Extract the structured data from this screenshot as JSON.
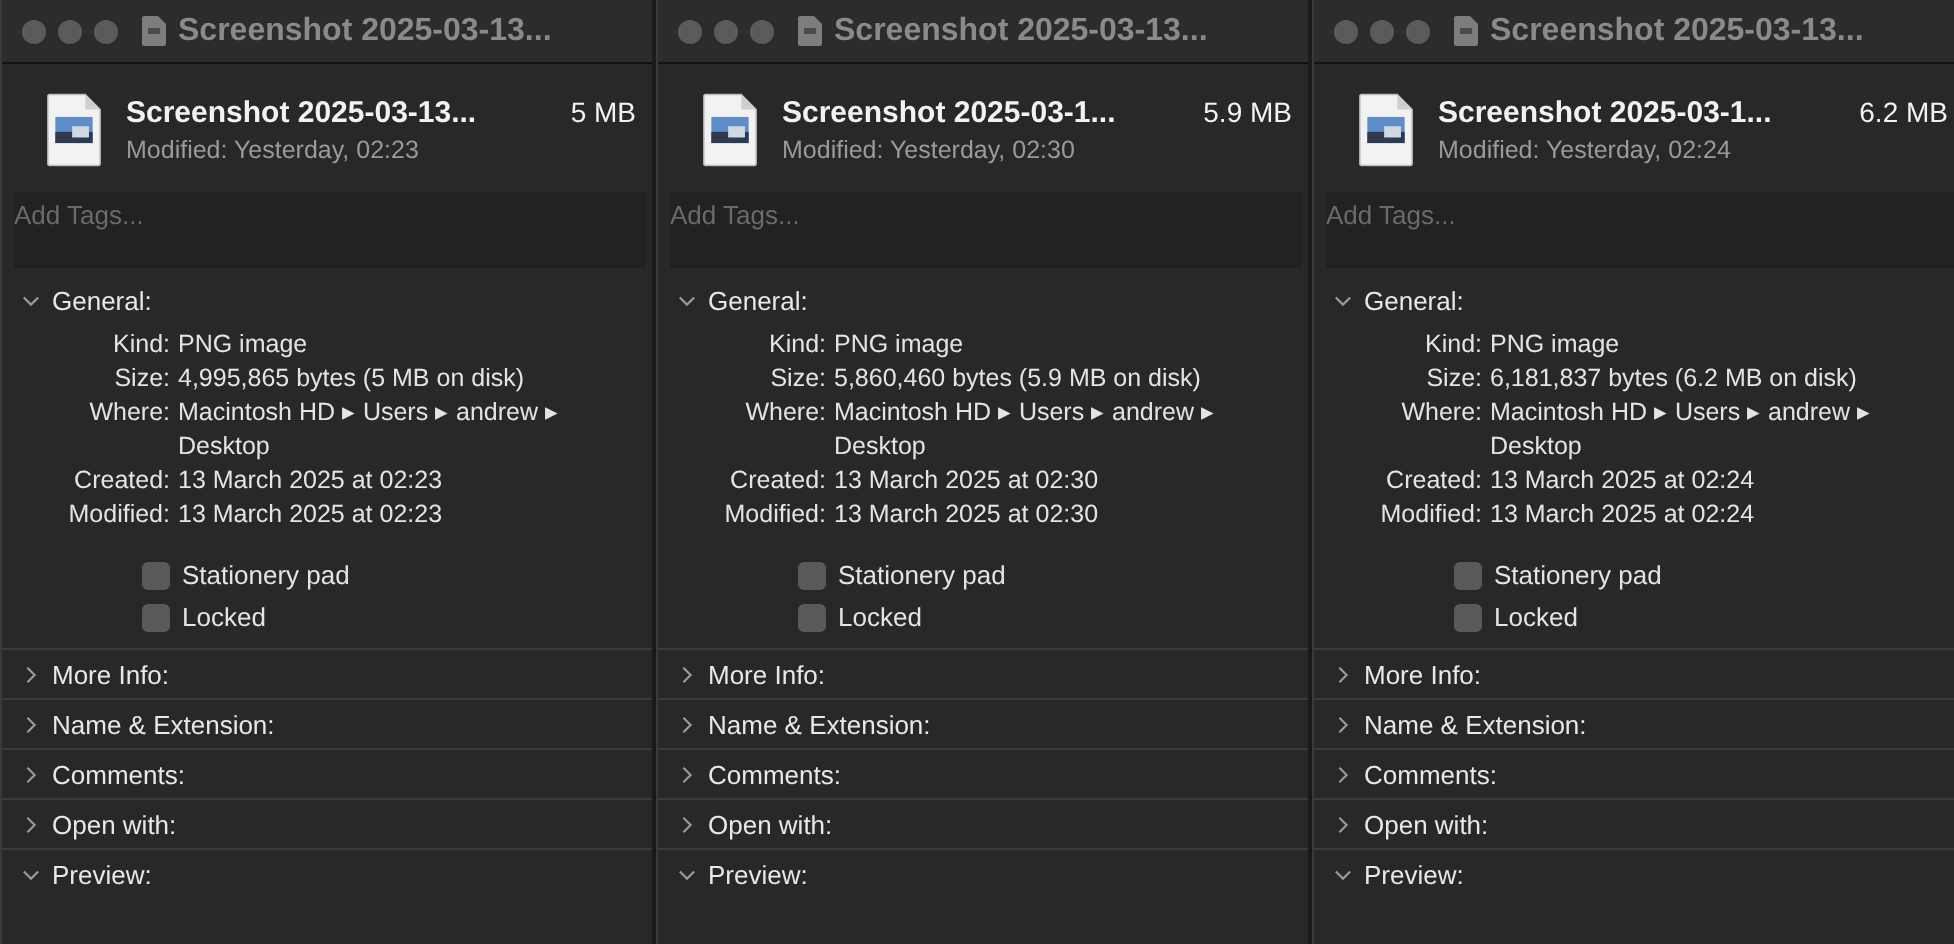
{
  "windows": [
    {
      "title": "Screenshot 2025-03-13...",
      "name": "Screenshot 2025-03-13...",
      "size": "5 MB",
      "modified": "Modified: Yesterday, 02:23",
      "tags": {
        "placeholder": "Add Tags..."
      },
      "general": {
        "label": "General:",
        "expanded": true,
        "fields": [
          {
            "label": "Kind:",
            "value": "PNG image"
          },
          {
            "label": "Size:",
            "value": "4,995,865 bytes (5 MB on disk)"
          },
          {
            "label": "Where:",
            "value": "Macintosh HD ▸ Users ▸ andrew ▸ Desktop"
          },
          {
            "label": "Created:",
            "value": "13 March 2025 at 02:23"
          },
          {
            "label": "Modified:",
            "value": "13 March 2025 at 02:23"
          }
        ],
        "checkboxes": [
          {
            "label": "Stationery pad",
            "checked": false
          },
          {
            "label": "Locked",
            "checked": false
          }
        ]
      },
      "sections": [
        {
          "label": "More Info:",
          "expanded": false
        },
        {
          "label": "Name & Extension:",
          "expanded": false
        },
        {
          "label": "Comments:",
          "expanded": false
        },
        {
          "label": "Open with:",
          "expanded": false
        },
        {
          "label": "Preview:",
          "expanded": true
        }
      ]
    },
    {
      "title": "Screenshot 2025-03-13...",
      "name": "Screenshot 2025-03-1...",
      "size": "5.9 MB",
      "modified": "Modified: Yesterday, 02:30",
      "tags": {
        "placeholder": "Add Tags..."
      },
      "general": {
        "label": "General:",
        "expanded": true,
        "fields": [
          {
            "label": "Kind:",
            "value": "PNG image"
          },
          {
            "label": "Size:",
            "value": "5,860,460 bytes (5.9 MB on disk)"
          },
          {
            "label": "Where:",
            "value": "Macintosh HD ▸ Users ▸ andrew ▸ Desktop"
          },
          {
            "label": "Created:",
            "value": "13 March 2025 at 02:30"
          },
          {
            "label": "Modified:",
            "value": "13 March 2025 at 02:30"
          }
        ],
        "checkboxes": [
          {
            "label": "Stationery pad",
            "checked": false
          },
          {
            "label": "Locked",
            "checked": false
          }
        ]
      },
      "sections": [
        {
          "label": "More Info:",
          "expanded": false
        },
        {
          "label": "Name & Extension:",
          "expanded": false
        },
        {
          "label": "Comments:",
          "expanded": false
        },
        {
          "label": "Open with:",
          "expanded": false
        },
        {
          "label": "Preview:",
          "expanded": true
        }
      ]
    },
    {
      "title": "Screenshot 2025-03-13...",
      "name": "Screenshot 2025-03-1...",
      "size": "6.2 MB",
      "modified": "Modified: Yesterday, 02:24",
      "tags": {
        "placeholder": "Add Tags..."
      },
      "general": {
        "label": "General:",
        "expanded": true,
        "fields": [
          {
            "label": "Kind:",
            "value": "PNG image"
          },
          {
            "label": "Size:",
            "value": "6,181,837 bytes (6.2 MB on disk)"
          },
          {
            "label": "Where:",
            "value": "Macintosh HD ▸ Users ▸ andrew ▸ Desktop"
          },
          {
            "label": "Created:",
            "value": "13 March 2025 at 02:24"
          },
          {
            "label": "Modified:",
            "value": "13 March 2025 at 02:24"
          }
        ],
        "checkboxes": [
          {
            "label": "Stationery pad",
            "checked": false
          },
          {
            "label": "Locked",
            "checked": false
          }
        ]
      },
      "sections": [
        {
          "label": "More Info:",
          "expanded": false
        },
        {
          "label": "Name & Extension:",
          "expanded": false
        },
        {
          "label": "Comments:",
          "expanded": false
        },
        {
          "label": "Open with:",
          "expanded": false
        },
        {
          "label": "Preview:",
          "expanded": true
        }
      ]
    }
  ]
}
